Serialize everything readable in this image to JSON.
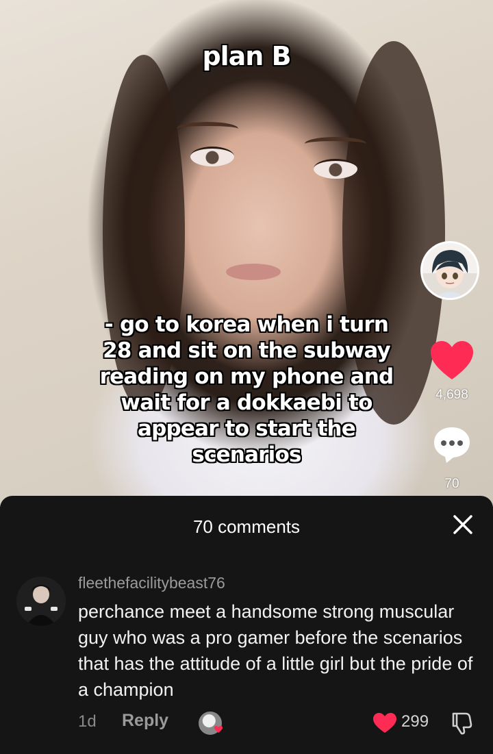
{
  "video": {
    "title_text": "plan B",
    "overlay_lines": [
      "- go to korea when i turn",
      "28 and sit on the subway",
      "reading on my phone and",
      "wait for a dokkaebi to",
      "appear to start the",
      "scenarios"
    ]
  },
  "rail": {
    "like_count": "4,698",
    "comment_count": "70",
    "like_color": "#fe2c55"
  },
  "comments_sheet": {
    "title": "70 comments",
    "close_icon": "close-icon",
    "comment": {
      "username": "fleethefacilitybeast76",
      "text": "perchance meet a handsome strong muscular guy who was a pro gamer before the scenarios that has the attitude of a little girl but the pride of a champion",
      "age": "1d",
      "reply_label": "Reply",
      "like_count": "299"
    }
  }
}
